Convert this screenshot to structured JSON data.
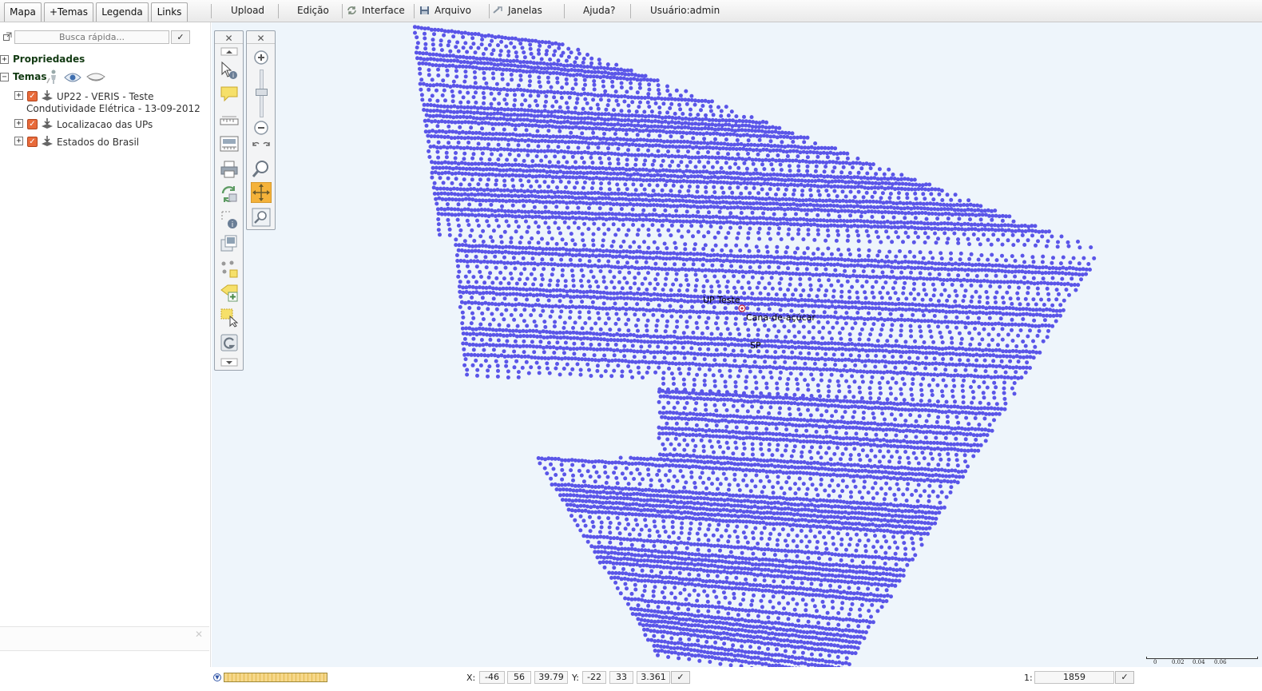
{
  "tabs": [
    "Mapa",
    "+Temas",
    "Legenda",
    "Links"
  ],
  "menu": {
    "upload": "Upload",
    "edicao": "Edição",
    "interface": "Interface",
    "arquivo": "Arquivo",
    "janelas": "Janelas",
    "ajuda": "Ajuda?",
    "usuario": "Usuário:admin"
  },
  "search": {
    "placeholder": "Busca rápida...",
    "ok": "✓"
  },
  "tree": {
    "propriedades": "Propriedades",
    "temas": "Temas",
    "layers": [
      {
        "label": "UP22 - VERIS - Teste",
        "sublabel": "Condutividade Elétrica - 13-09-2012",
        "checked": true
      },
      {
        "label": "Localizacao das UPs",
        "checked": true
      },
      {
        "label": "Estados do Brasil",
        "checked": true
      }
    ]
  },
  "map": {
    "point_color": "#5a55e8",
    "background": "#eef5fb",
    "labels": {
      "up": "UP Teste",
      "crop": "Cana-de-açúcar",
      "state": "SP"
    }
  },
  "toolbar": {
    "close": "✕"
  },
  "coords": {
    "x_label": "X:",
    "x_deg": "-46",
    "x_min": "56",
    "x_sec": "39.79",
    "y_label": "Y:",
    "y_deg": "-22",
    "y_min": "33",
    "y_sec": "3.361",
    "ok": "✓"
  },
  "scale": {
    "prefix": "1:",
    "value": "1859",
    "ok": "✓",
    "ticks": [
      "0",
      "0.02",
      "0.04",
      "0.06"
    ]
  }
}
